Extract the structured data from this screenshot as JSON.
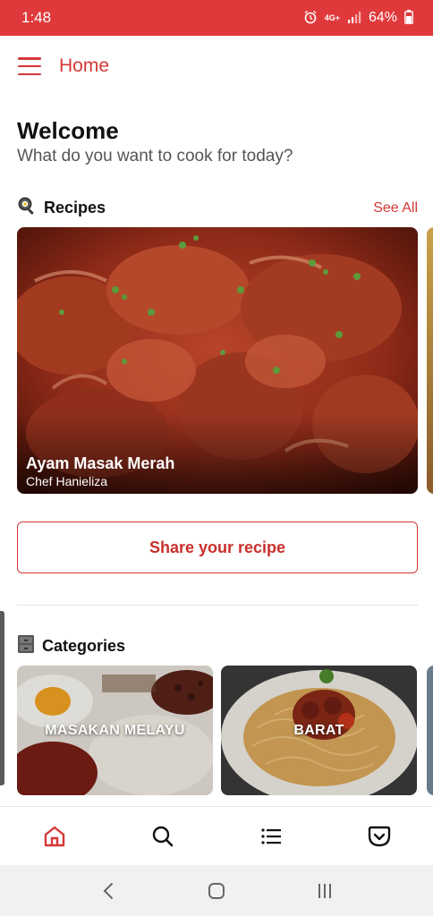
{
  "status_bar": {
    "time": "1:48",
    "network": "4G+",
    "battery": "64%"
  },
  "app_bar": {
    "title": "Home",
    "menu_icon": "hamburger-icon"
  },
  "welcome": {
    "title": "Welcome",
    "subtitle": "What do you want to cook for today?"
  },
  "recipes": {
    "title": "Recipes",
    "icon": "frying-pan-icon",
    "see_all": "See All",
    "items": [
      {
        "name": "Ayam Masak Merah",
        "chef": "Chef Hanieliza"
      }
    ]
  },
  "share_button": "Share your recipe",
  "categories": {
    "title": "Categories",
    "icon": "file-cabinet-icon",
    "items": [
      {
        "label": "MASAKAN MELAYU"
      },
      {
        "label": "BARAT"
      }
    ]
  },
  "bottom_nav": [
    {
      "name": "home-icon",
      "active": true
    },
    {
      "name": "search-icon",
      "active": false
    },
    {
      "name": "list-icon",
      "active": false
    },
    {
      "name": "pocket-icon",
      "active": false
    }
  ],
  "colors": {
    "accent": "#d63737",
    "status_bar": "#e0393b"
  }
}
